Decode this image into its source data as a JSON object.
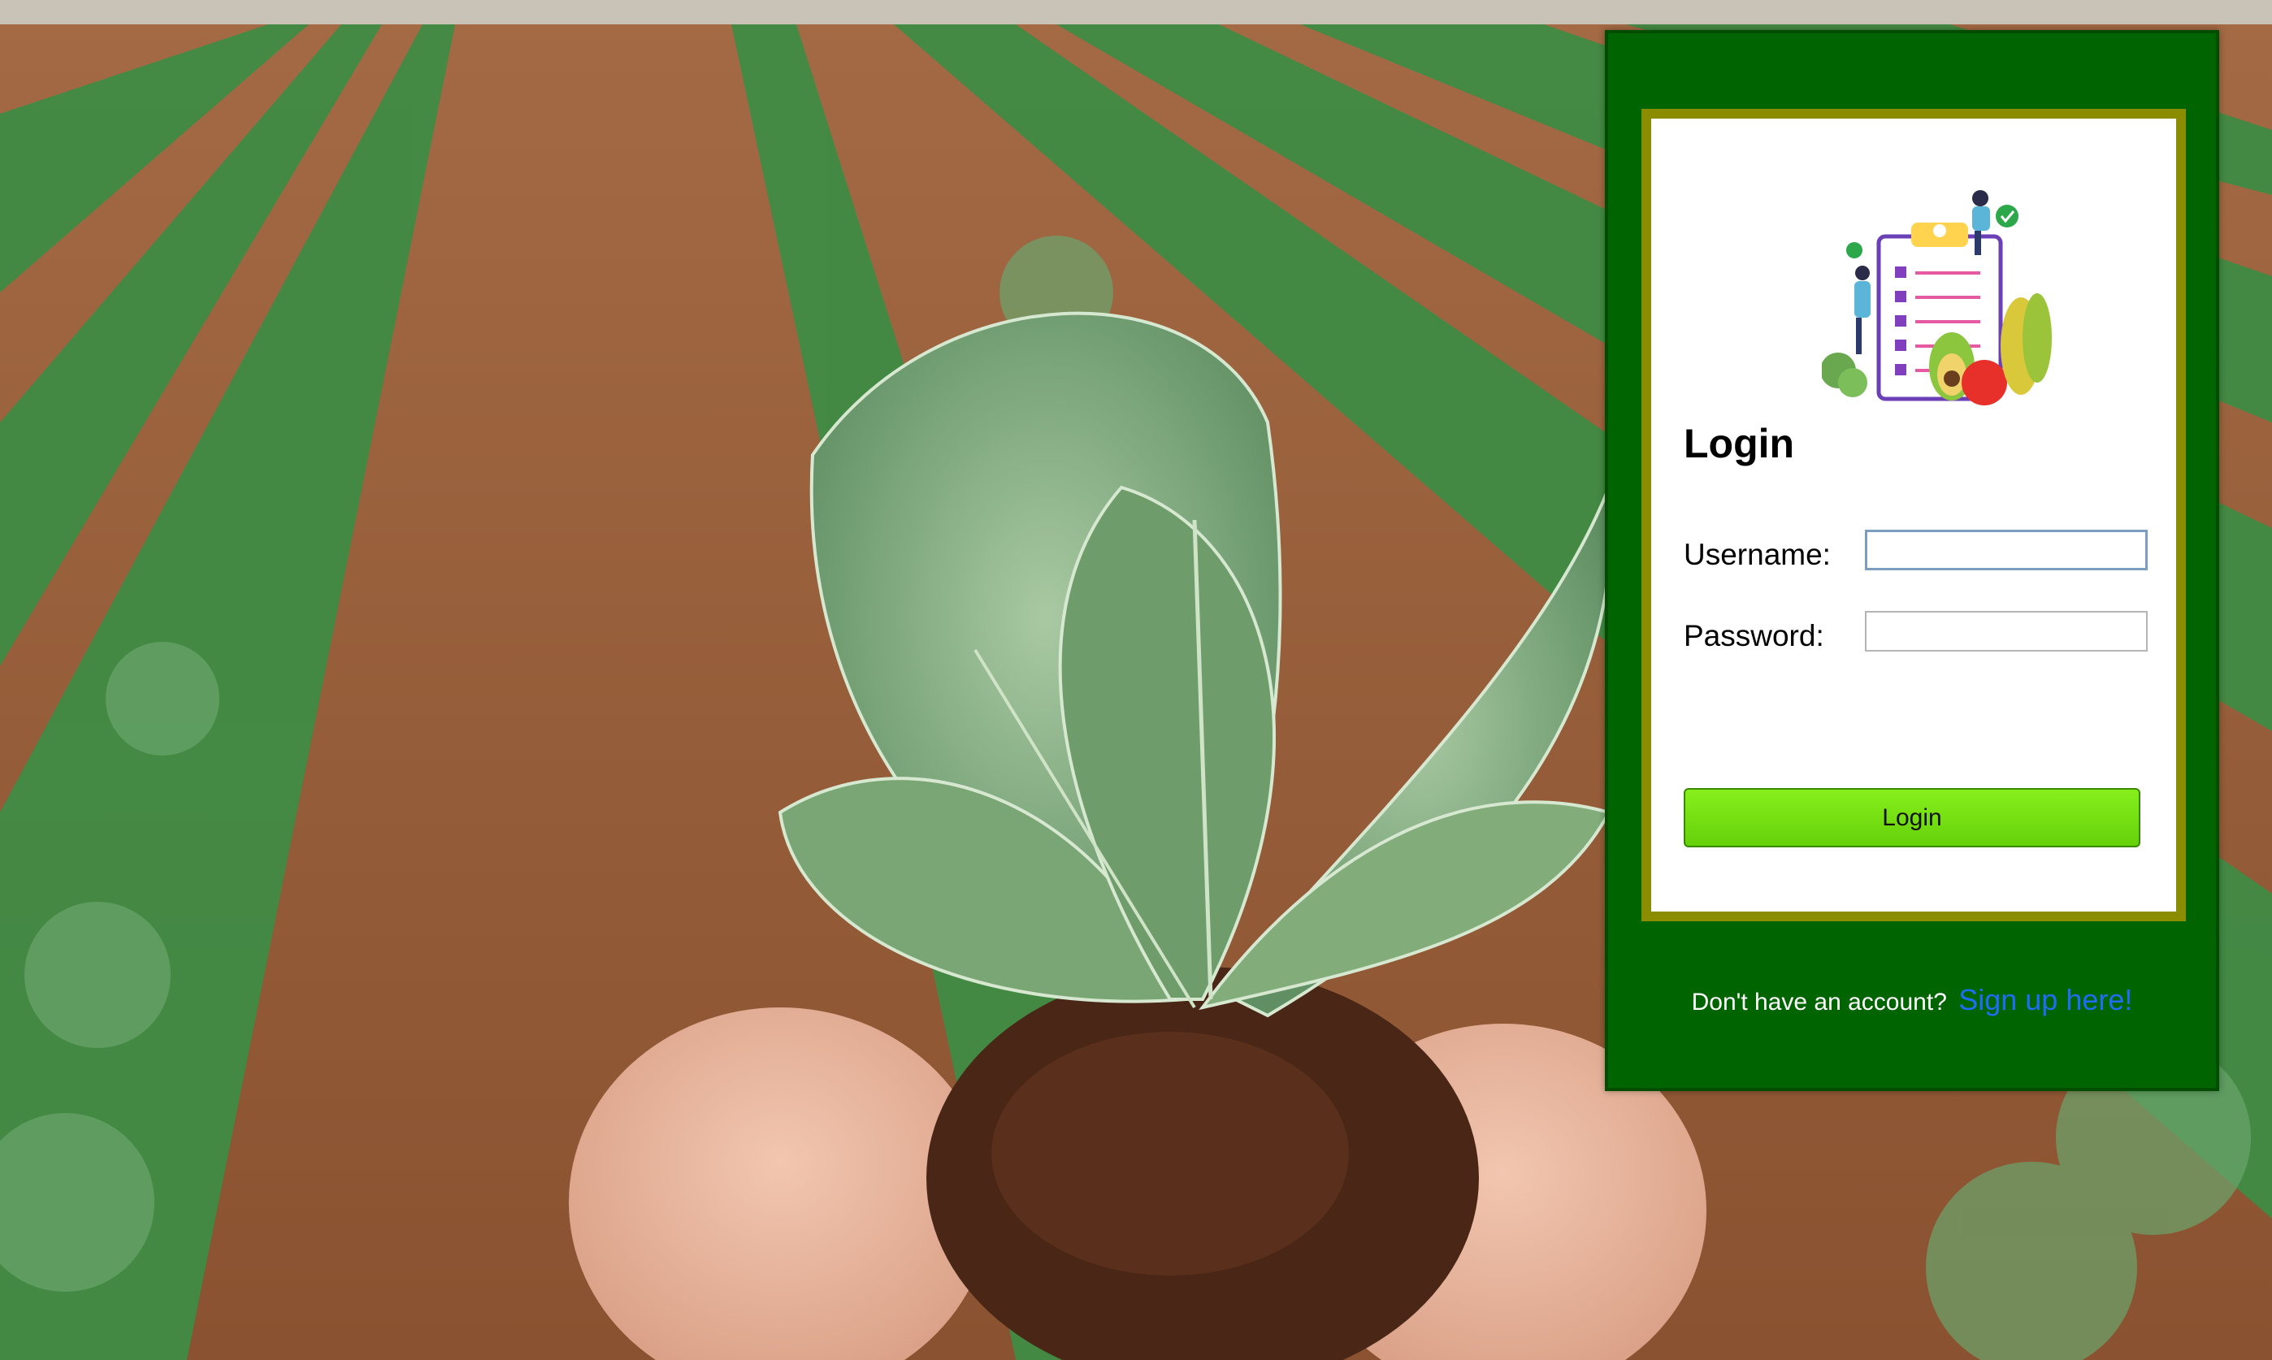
{
  "login": {
    "heading": "Login",
    "username_label": "Username:",
    "password_label": "Password:",
    "username_value": "",
    "password_value": "",
    "button_label": "Login",
    "signup_prompt": "Don't have an account?",
    "signup_link": "Sign up here!"
  },
  "colors": {
    "panel_background": "#006400",
    "card_border": "#8c8c00",
    "button": "#77e212",
    "link": "#1d6ef5"
  },
  "icons": {
    "illustration": "checklist-with-people-and-vegetables"
  }
}
